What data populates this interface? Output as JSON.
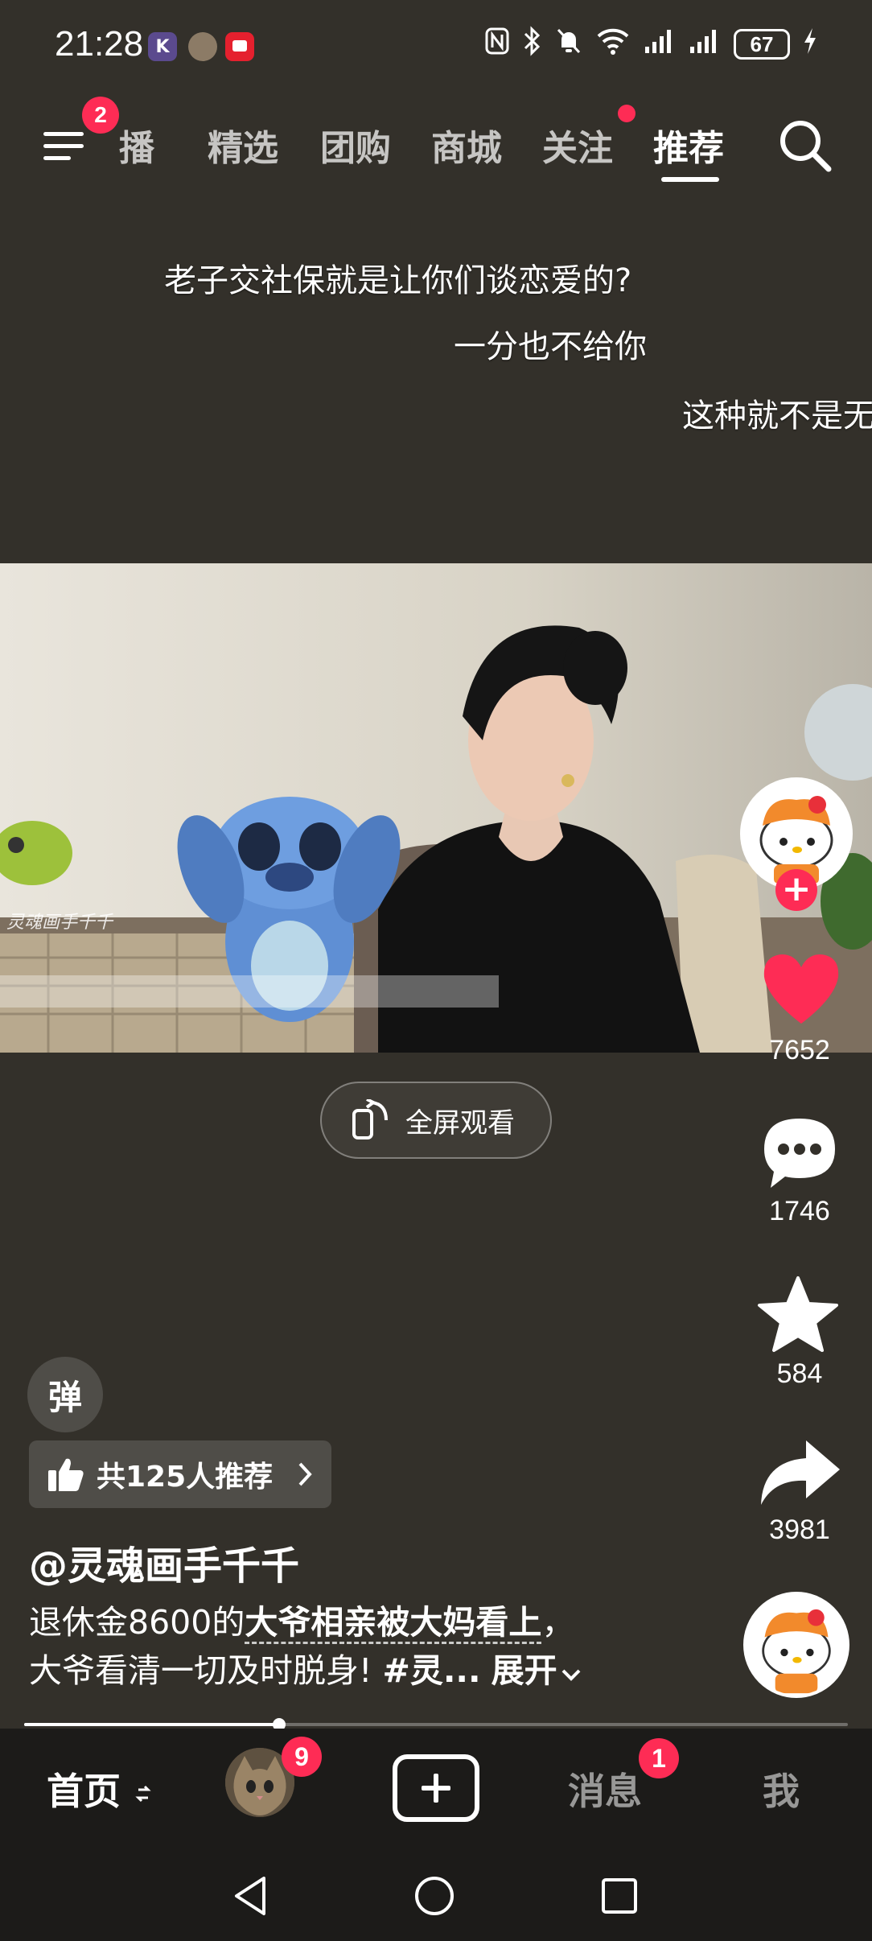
{
  "status_bar": {
    "time": "21:28",
    "battery": "67",
    "icons": [
      "nfc-icon",
      "bluetooth-icon",
      "mute-bell-icon",
      "wifi-icon",
      "signal-icon",
      "signal-icon",
      "charging-icon"
    ]
  },
  "top_nav": {
    "menu_badge": "2",
    "tabs": [
      {
        "label": "直播",
        "visible_text": "播"
      },
      {
        "label": "精选"
      },
      {
        "label": "团购"
      },
      {
        "label": "商城"
      },
      {
        "label": "关注"
      },
      {
        "label": "推荐",
        "active": true
      }
    ]
  },
  "danmaku": [
    "老子交社保就是让你们谈恋爱的?",
    "一分也不给你",
    "这种就不是无"
  ],
  "video": {
    "watermark": "灵魂画手千千",
    "fullscreen_label": "全屏观看"
  },
  "actions": {
    "likes": "7652",
    "comments": "1746",
    "favorites": "584",
    "shares": "3981"
  },
  "info": {
    "danmaku_toggle": "弹",
    "recommend": "共125人推荐",
    "author": "@灵魂画手千千",
    "caption_part1": "退休金8600的",
    "caption_bold": "大爷相亲被大妈看上",
    "caption_part2": "，",
    "caption_line2": "大爷看清一切及时脱身!",
    "caption_tag": "#灵...",
    "expand": "展开"
  },
  "progress": 0.31,
  "bottom_tabs": {
    "home": "首页",
    "friends_badge": "9",
    "messages": "消息",
    "messages_badge": "1",
    "me": "我"
  },
  "colors": {
    "accent": "#fe2c55",
    "background": "#33302a",
    "tab_bar": "#1c1b19"
  }
}
